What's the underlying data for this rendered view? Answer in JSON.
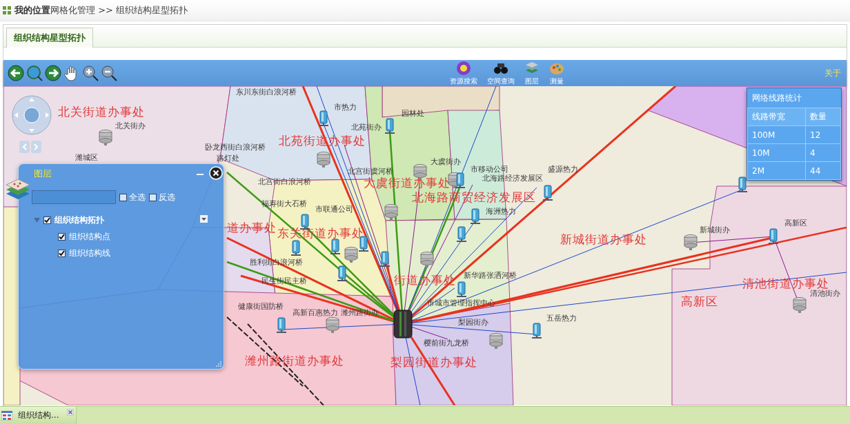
{
  "breadcrumb": "**我的位置**网格化管理 >> 组织结构星型拓扑",
  "tabs": [
    {
      "label": "组织结构星型拓扑",
      "selected": true
    }
  ],
  "toolbar": {
    "tools": [
      {
        "label": "资源搜索"
      },
      {
        "label": "空间查询"
      },
      {
        "label": "图层"
      },
      {
        "label": "测量"
      }
    ],
    "about": "关于"
  },
  "map": {
    "districts": [
      "北关街道办事处",
      "北苑街道办事处",
      "大虞街道办事处",
      "北海路商贸经济发展区",
      "道办事处",
      "东关街道办事处",
      "新城街道办事处",
      "街道办事处",
      "高新区",
      "清池街道办事处",
      "潍州路街道办事处",
      "梨园街道办事处"
    ],
    "places": [
      "东川东街白浪河桥",
      "市热力",
      "北苑街办",
      "园林处",
      "北关街办",
      "潍城区",
      "卧龙西街白浪河桥",
      "路灯处",
      "北宫街虞河桥",
      "大虞街办",
      "市移动公司",
      "北海路经济发展区",
      "盛源热力",
      "北宫街白浪河桥",
      "福寿街大石桥",
      "市联通公司",
      "海洲热力",
      "胜利街白浪河桥",
      "民生街民主桥",
      "新华路张洒河桥",
      "市城市管理指挥中心",
      "健康街国防桥",
      "高新百惠热力",
      "潍州路街办",
      "梨园街办",
      "五岳热力",
      "樱前街九龙桥",
      "新城街办",
      "高新区",
      "清池街办"
    ]
  },
  "stats": {
    "title": "网络线路统计",
    "columns": [
      "线路带宽",
      "数量"
    ],
    "rows": [
      [
        "100M",
        "12"
      ],
      [
        "10M",
        "4"
      ],
      [
        "2M",
        "44"
      ]
    ]
  },
  "layer_panel": {
    "title": "图层",
    "options": [
      {
        "label": "全选",
        "checked": false
      },
      {
        "label": "反选",
        "checked": false
      }
    ],
    "tree": [
      {
        "label": "组织结构拓扑",
        "checked": true,
        "expanded": true,
        "children": [
          {
            "label": "组织结构点",
            "checked": true
          },
          {
            "label": "组织结构线",
            "checked": true
          }
        ]
      }
    ]
  },
  "taskbar": [
    {
      "label": "组织结构..."
    }
  ]
}
